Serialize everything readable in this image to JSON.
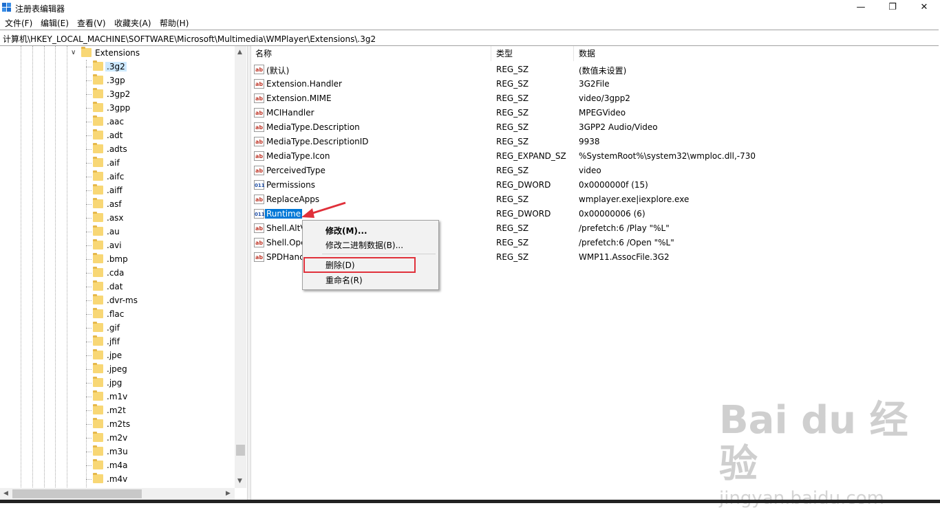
{
  "window": {
    "title": "注册表编辑器",
    "minimize_glyph": "—",
    "maximize_glyph": "❐",
    "close_glyph": "✕"
  },
  "menu": [
    "文件(F)",
    "编辑(E)",
    "查看(V)",
    "收藏夹(A)",
    "帮助(H)"
  ],
  "address": "计算机\\HKEY_LOCAL_MACHINE\\SOFTWARE\\Microsoft\\Multimedia\\WMPlayer\\Extensions\\.3g2",
  "tree": {
    "parent": "Extensions",
    "items": [
      ".3g2",
      ".3gp",
      ".3gp2",
      ".3gpp",
      ".aac",
      ".adt",
      ".adts",
      ".aif",
      ".aifc",
      ".aiff",
      ".asf",
      ".asx",
      ".au",
      ".avi",
      ".bmp",
      ".cda",
      ".dat",
      ".dvr-ms",
      ".flac",
      ".gif",
      ".jfif",
      ".jpe",
      ".jpeg",
      ".jpg",
      ".m1v",
      ".m2t",
      ".m2ts",
      ".m2v",
      ".m3u",
      ".m4a",
      ".m4v"
    ],
    "selected": ".3g2"
  },
  "columns": {
    "name": "名称",
    "type": "类型",
    "data": "数据"
  },
  "rows": [
    {
      "icon": "string-value-icon",
      "name": "(默认)",
      "type": "REG_SZ",
      "data": "(数值未设置)"
    },
    {
      "icon": "string-value-icon",
      "name": "Extension.Handler",
      "type": "REG_SZ",
      "data": "3G2File"
    },
    {
      "icon": "string-value-icon",
      "name": "Extension.MIME",
      "type": "REG_SZ",
      "data": "video/3gpp2"
    },
    {
      "icon": "string-value-icon",
      "name": "MCIHandler",
      "type": "REG_SZ",
      "data": "MPEGVideo"
    },
    {
      "icon": "string-value-icon",
      "name": "MediaType.Description",
      "type": "REG_SZ",
      "data": "3GPP2 Audio/Video"
    },
    {
      "icon": "string-value-icon",
      "name": "MediaType.DescriptionID",
      "type": "REG_SZ",
      "data": "9938"
    },
    {
      "icon": "string-value-icon",
      "name": "MediaType.Icon",
      "type": "REG_EXPAND_SZ",
      "data": "%SystemRoot%\\system32\\wmploc.dll,-730"
    },
    {
      "icon": "string-value-icon",
      "name": "PerceivedType",
      "type": "REG_SZ",
      "data": "video"
    },
    {
      "icon": "dword-value-icon",
      "name": "Permissions",
      "type": "REG_DWORD",
      "data": "0x0000000f (15)"
    },
    {
      "icon": "string-value-icon",
      "name": "ReplaceApps",
      "type": "REG_SZ",
      "data": "wmplayer.exe|iexplore.exe"
    },
    {
      "icon": "dword-value-icon",
      "name": "Runtime",
      "type": "REG_DWORD",
      "data": "0x00000006 (6)"
    },
    {
      "icon": "string-value-icon",
      "name": "Shell.AltV",
      "type": "REG_SZ",
      "data": "/prefetch:6 /Play \"%L\""
    },
    {
      "icon": "string-value-icon",
      "name": "Shell.Ope",
      "type": "REG_SZ",
      "data": "/prefetch:6 /Open \"%L\""
    },
    {
      "icon": "string-value-icon",
      "name": "SPDHanc",
      "type": "REG_SZ",
      "data": "WMP11.AssocFile.3G2"
    }
  ],
  "icon_glyphs": {
    "string": "ab",
    "dword": "011"
  },
  "context_menu": {
    "modify": "修改(M)...",
    "modify_binary": "修改二进制数据(B)...",
    "delete": "删除(D)",
    "rename": "重命名(R)"
  },
  "watermark": {
    "logo": "Bai du 经验",
    "url": "jingyan.baidu.com"
  },
  "colors": {
    "selection": "#0078d7",
    "annotation": "#e0303a",
    "folder": "#f8d775"
  }
}
